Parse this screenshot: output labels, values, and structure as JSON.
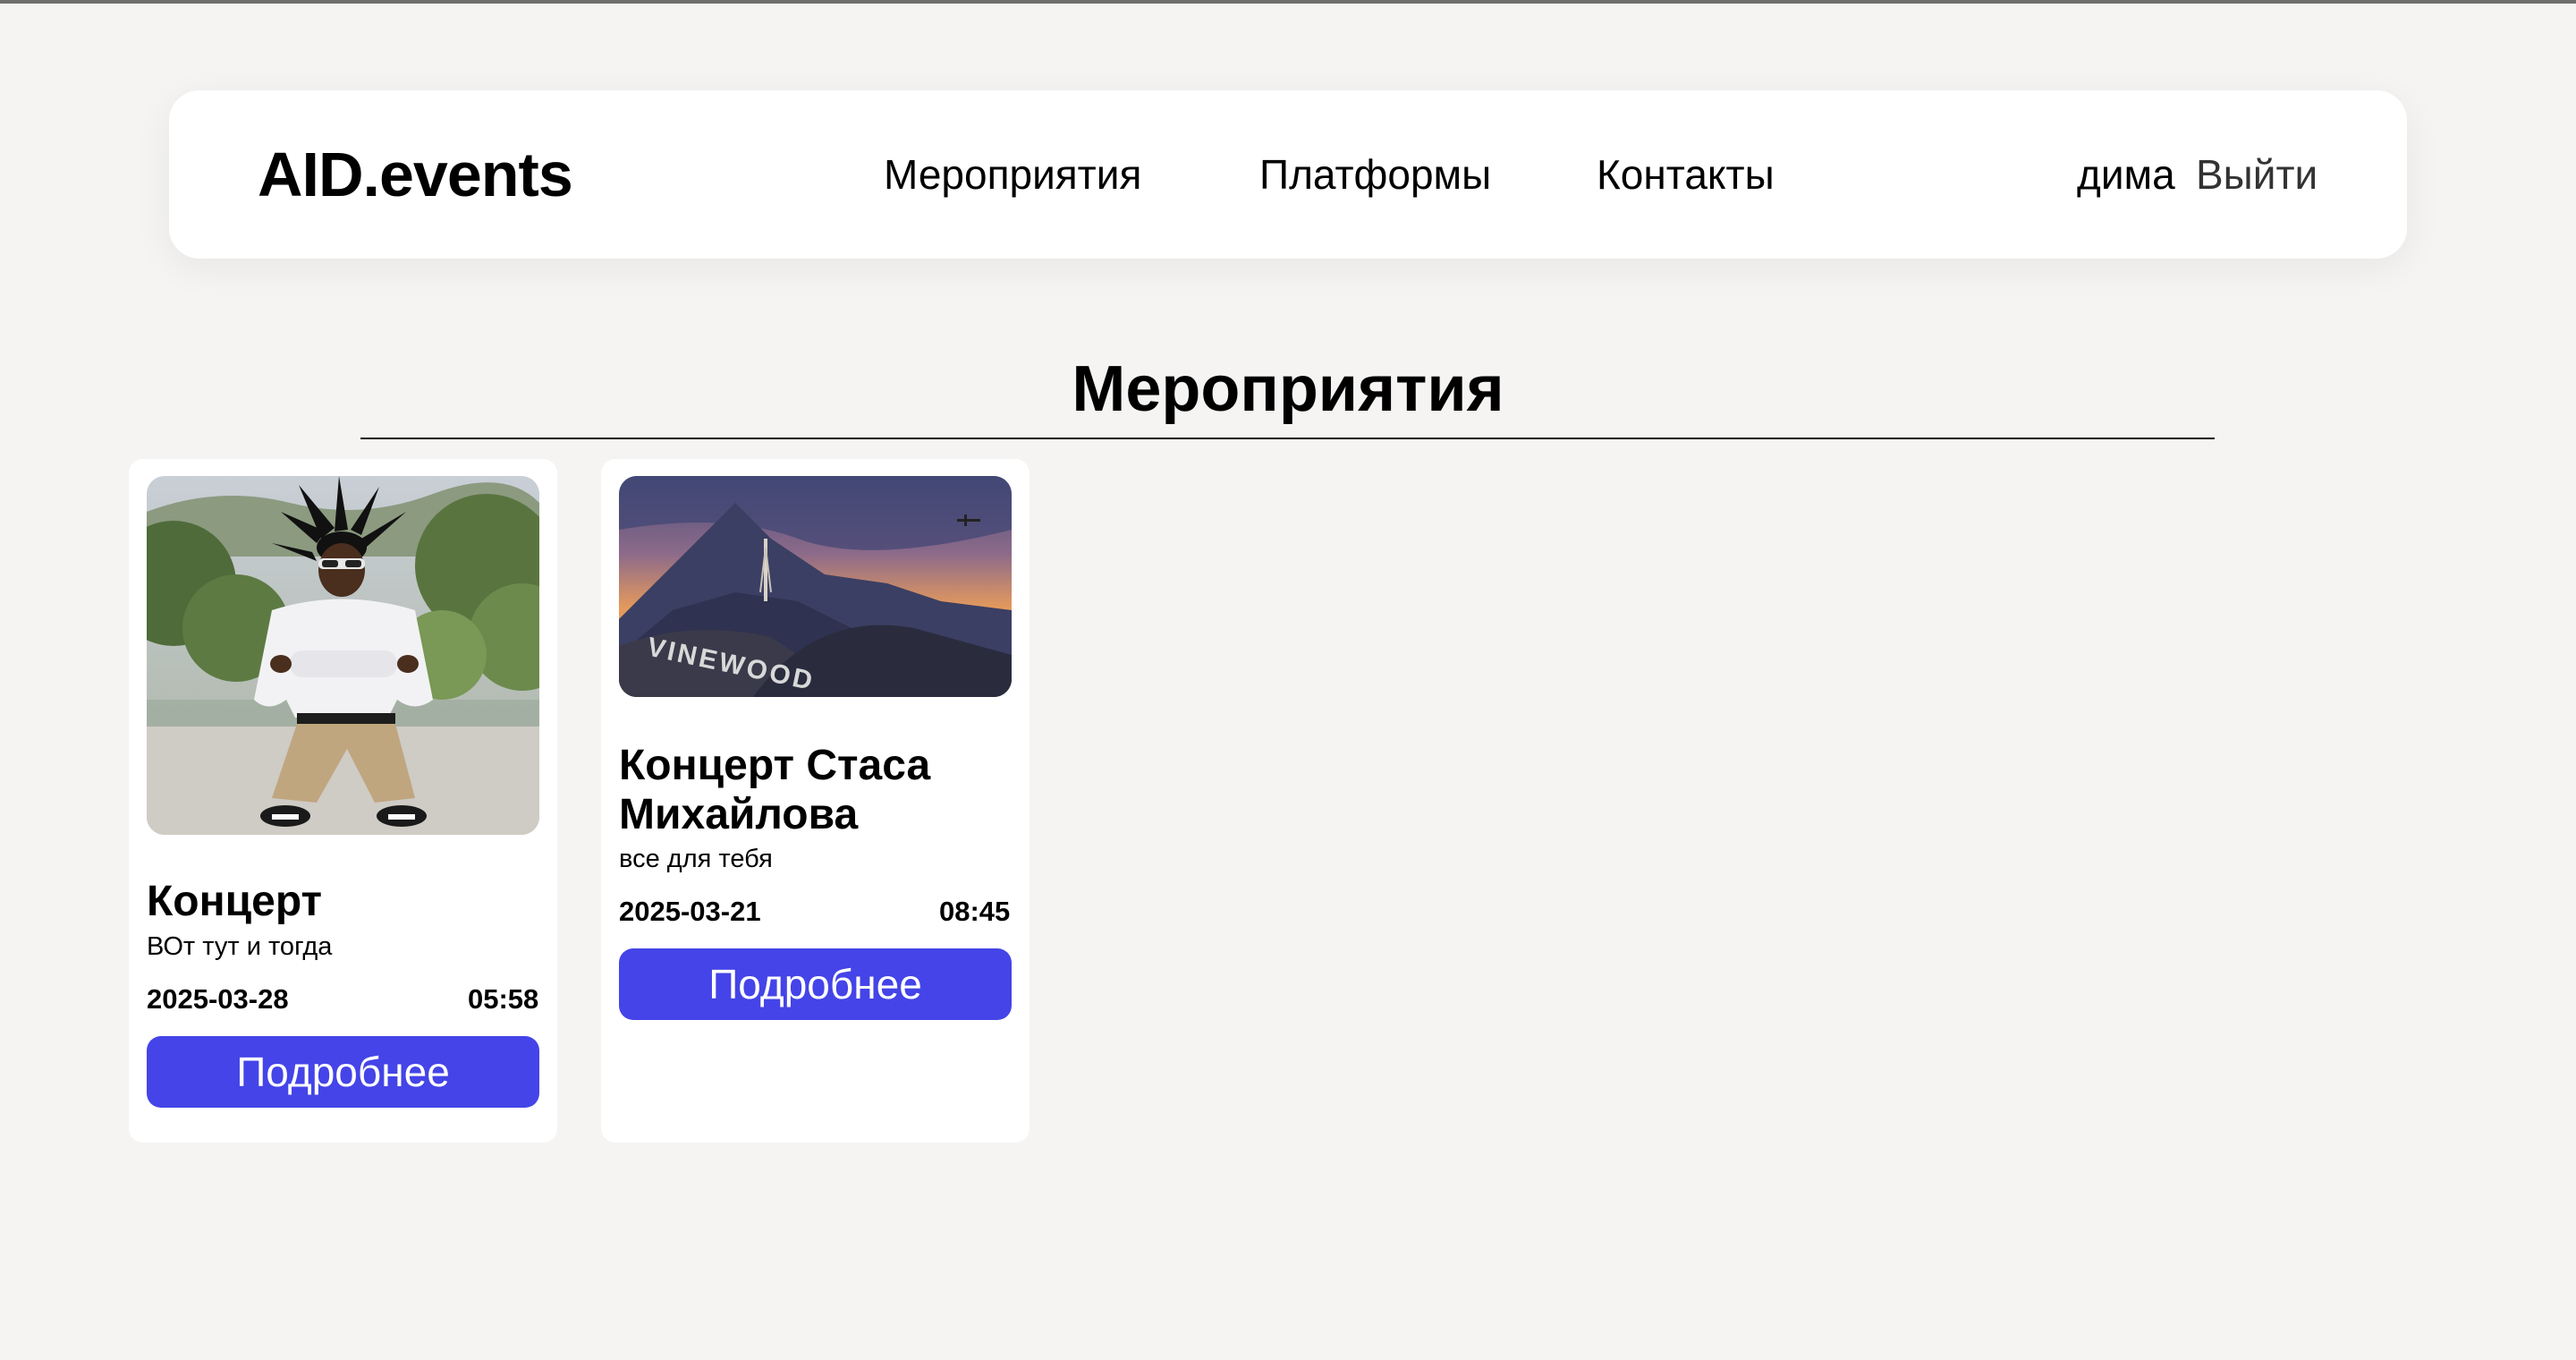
{
  "header": {
    "logo": "AID.events",
    "nav": [
      {
        "label": "Мероприятия"
      },
      {
        "label": "Платформы"
      },
      {
        "label": "Контакты"
      }
    ],
    "user_name": "дима",
    "logout_label": "Выйти"
  },
  "main": {
    "title": "Мероприятия",
    "events": [
      {
        "title": "Концерт",
        "description": "ВОт тут и тогда",
        "date": "2025-03-28",
        "time": "05:58",
        "button_label": "Подробнее",
        "image": "person-portrait-photo"
      },
      {
        "title": "Концерт Стаса Михайлова",
        "description": "все для тебя",
        "date": "2025-03-21",
        "time": "08:45",
        "button_label": "Подробнее",
        "image": "vinewood-sunset-photo"
      }
    ]
  },
  "colors": {
    "background": "#f5f4f2",
    "card": "#ffffff",
    "accent": "#4444e8"
  }
}
